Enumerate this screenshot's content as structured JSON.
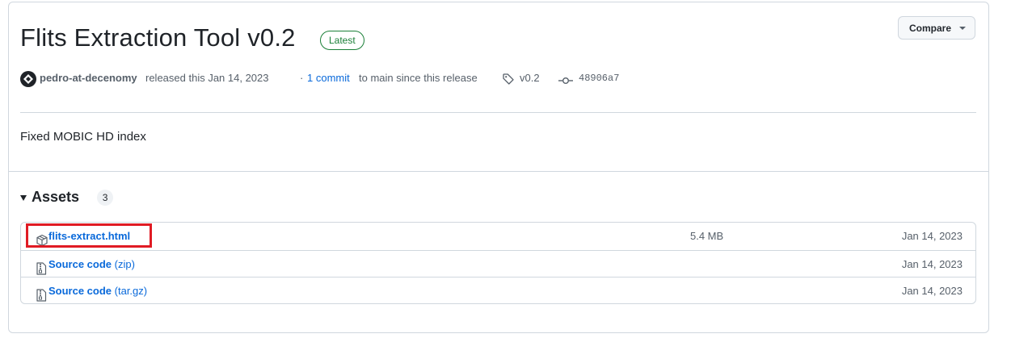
{
  "release": {
    "title": "Flits Extraction Tool v0.2",
    "badge": "Latest",
    "compare_label": "Compare",
    "author": "pedro-at-decenomy",
    "released_text": "released this Jan 14, 2023",
    "dot": "·",
    "commit_link": "1 commit",
    "commit_rest": "to main since this release",
    "tag": "v0.2",
    "sha": "48906a7",
    "description": "Fixed MOBIC HD index"
  },
  "assets": {
    "title": "Assets",
    "count": "3",
    "items": [
      {
        "name": "flits-extract.html",
        "suffix": "",
        "size": "5.4 MB",
        "date": "Jan 14, 2023",
        "icon": "package-icon",
        "highlighted": true
      },
      {
        "name": "Source code",
        "suffix": " (zip)",
        "size": "",
        "date": "Jan 14, 2023",
        "icon": "file-zip-icon",
        "highlighted": false
      },
      {
        "name": "Source code",
        "suffix": " (tar.gz)",
        "size": "",
        "date": "Jan 14, 2023",
        "icon": "file-zip-icon",
        "highlighted": false
      }
    ]
  },
  "colors": {
    "link": "#0969da",
    "badge_green": "#1a7f37",
    "highlight_red": "#e01b24",
    "border": "#d0d7de",
    "muted_text": "#57606a"
  }
}
